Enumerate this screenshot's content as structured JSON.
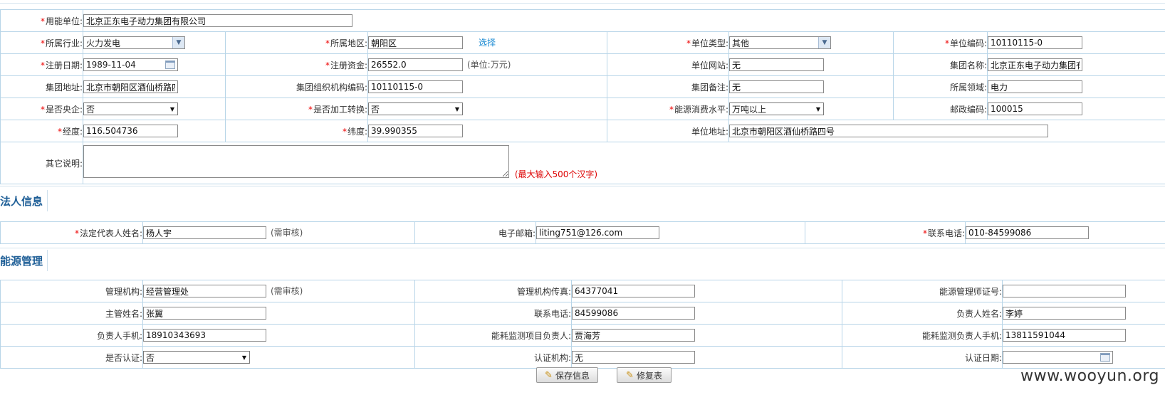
{
  "company": {
    "unit_label": "用能单位:",
    "unit_value": "北京正东电子动力集团有限公司",
    "industry_label": "所属行业:",
    "industry_value": "火力发电",
    "region_label": "所属地区:",
    "region_value": "朝阳区",
    "region_link": "选择",
    "unit_type_label": "单位类型:",
    "unit_type_value": "其他",
    "unit_code_label": "单位编码:",
    "unit_code_value": "10110115-0",
    "reg_date_label": "注册日期:",
    "reg_date_value": "1989-11-04",
    "capital_label": "注册资金:",
    "capital_value": "26552.0",
    "capital_unit": "(单位:万元)",
    "website_label": "单位网站:",
    "website_value": "无",
    "group_name_label": "集团名称:",
    "group_name_value": "北京正东电子动力集团有限公司",
    "group_addr_label": "集团地址:",
    "group_addr_value": "北京市朝阳区酒仙桥路四号",
    "group_org_code_label": "集团组织机构编码:",
    "group_org_code_value": "10110115-0",
    "group_note_label": "集团备注:",
    "group_note_value": "无",
    "domain_label": "所属领域:",
    "domain_value": "电力",
    "central_label": "是否央企:",
    "central_value": "否",
    "processing_label": "是否加工转换:",
    "processing_value": "否",
    "energy_level_label": "能源消费水平:",
    "energy_level_value": "万吨以上",
    "postcode_label": "邮政编码:",
    "postcode_value": "100015",
    "lng_label": "经度:",
    "lng_value": "116.504736",
    "lat_label": "纬度:",
    "lat_value": "39.990355",
    "address_label": "单位地址:",
    "address_value": "北京市朝阳区酒仙桥路四号",
    "other_label": "其它说明:",
    "other_value": "",
    "other_hint": "(最大输入500个汉字)"
  },
  "legal": {
    "section_title": "法人信息",
    "rep_label": "法定代表人姓名:",
    "rep_value": "杨人宇",
    "rep_hint": "(需审核)",
    "email_label": "电子邮箱:",
    "email_value": "liting751@126.com",
    "phone_label": "联系电话:",
    "phone_value": "010-84599086"
  },
  "energy": {
    "section_title": "能源管理",
    "org_label": "管理机构:",
    "org_value": "经营管理处",
    "org_hint": "(需审核)",
    "fax_label": "管理机构传真:",
    "fax_value": "64377041",
    "cert_no_label": "能源管理师证号:",
    "cert_no_value": "",
    "head_label": "主管姓名:",
    "head_value": "张翼",
    "tel_label": "联系电话:",
    "tel_value": "84599086",
    "resp_label": "负责人姓名:",
    "resp_value": "李婷",
    "resp_mobile_label": "负责人手机:",
    "resp_mobile_value": "18910343693",
    "monitor_resp_label": "能耗监测项目负责人:",
    "monitor_resp_value": "贾海芳",
    "monitor_mobile_label": "能耗监测负责人手机:",
    "monitor_mobile_value": "13811591044",
    "certified_label": "是否认证:",
    "certified_value": "否",
    "cert_org_label": "认证机构:",
    "cert_org_value": "无",
    "cert_date_label": "认证日期:",
    "cert_date_value": ""
  },
  "buttons": {
    "save": "保存信息",
    "modify": "修复表"
  },
  "watermark": "www.wooyun.org",
  "colors": {
    "border": "#b8d5e8",
    "section": "#1f5f97",
    "required": "#ee0000",
    "link": "#1a8ad2",
    "hint_red": "#d00000"
  }
}
